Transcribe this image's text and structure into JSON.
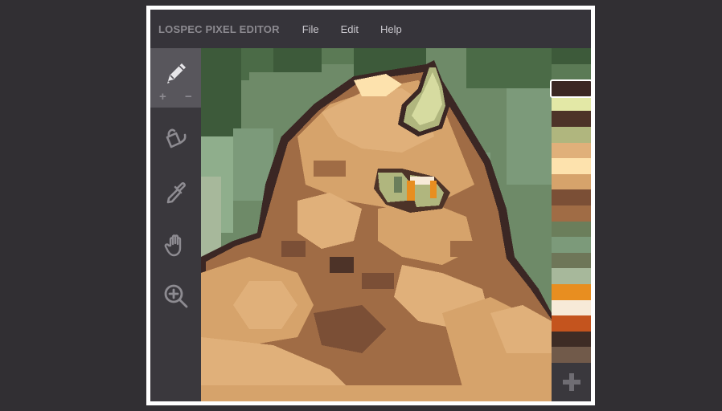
{
  "app": {
    "title": "LOSPEC PIXEL EDITOR",
    "menu": [
      {
        "label": "File"
      },
      {
        "label": "Edit"
      },
      {
        "label": "Help"
      }
    ]
  },
  "toolbar": {
    "tools": [
      {
        "name": "pencil-icon",
        "active": true
      },
      {
        "name": "paint-bucket-icon",
        "active": false
      },
      {
        "name": "eyedropper-icon",
        "active": false
      },
      {
        "name": "hand-icon",
        "active": false
      },
      {
        "name": "zoom-in-icon",
        "active": false
      }
    ],
    "size_increase": "+",
    "size_decrease": "−"
  },
  "palette": {
    "colors": [
      "#3d5a3a",
      "#5b7a55",
      "#3b2724",
      "#e3e8a6",
      "#4d3328",
      "#b0b67e",
      "#e0b07a",
      "#fde2ad",
      "#d6a36b",
      "#7b4f36",
      "#a06c45",
      "#6b7e5b",
      "#7c9a7a",
      "#6e7658",
      "#a7b89b",
      "#e88e20",
      "#f7ead8",
      "#c4541e",
      "#3e2c25",
      "#715a4a"
    ],
    "selected_index": 2,
    "add_icon": "plus-icon"
  }
}
